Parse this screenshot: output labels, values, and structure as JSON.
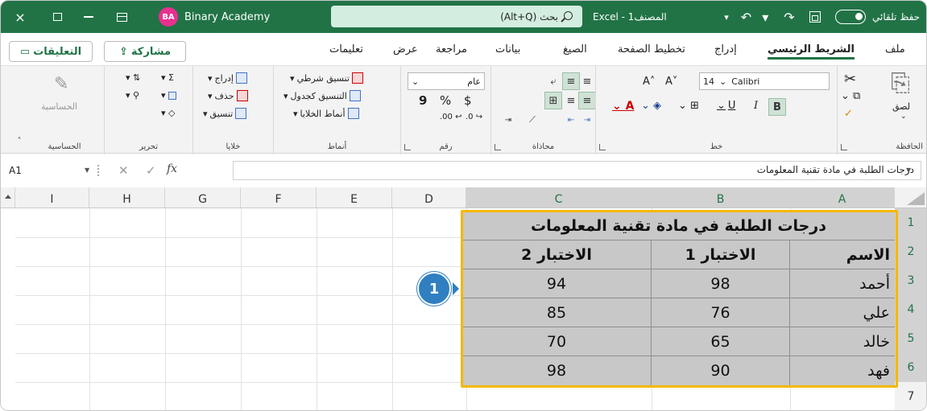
{
  "titlebar": {
    "close": "×",
    "avatar_initials": "BA",
    "user_name": "Binary Academy",
    "search_placeholder": "(Alt+Q) بحث",
    "document_title": "Excel - المصنف1",
    "customize": "▾",
    "undo": "↶ ▾",
    "redo": "↷",
    "autosave_label": "حفظ تلقائي",
    "accent_color": "#217346"
  },
  "tabs": {
    "file": "ملف",
    "home": "الشريط الرئيسي",
    "insert": "إدراج",
    "page_layout": "تخطيط الصفحة",
    "formulas": "الصيغ",
    "data": "بيانات",
    "review": "مراجعة",
    "view": "عرض",
    "help": "تعليمات",
    "share": "مشاركة",
    "comments": "التعليقات"
  },
  "ribbon": {
    "clipboard": {
      "label": "الحافظة",
      "paste": "لصق"
    },
    "font": {
      "label": "خط",
      "font_name": "Calibri",
      "font_size": "14",
      "bold": "B",
      "italic": "I",
      "underline": "U",
      "grow": "A˄",
      "shrink": "A˅"
    },
    "alignment": {
      "label": "محاذاة"
    },
    "number": {
      "label": "رقم",
      "format": "عام",
      "currency": "$",
      "percent": "%",
      "comma": "9"
    },
    "styles": {
      "label": "أنماط",
      "conditional": "تنسيق شرطي",
      "as_table": "التنسيق كجدول",
      "cell_styles": "أنماط الخلايا"
    },
    "cells": {
      "label": "خلايا",
      "insert": "إدراج",
      "delete": "حذف",
      "format": "تنسيق"
    },
    "editing": {
      "label": "تحرير"
    },
    "sensitivity": {
      "label": "الحساسية",
      "button": "الحساسية"
    }
  },
  "formula_bar": {
    "name_box": "A1",
    "fx": "fx",
    "content": "درجات الطلبة في مادة تقنية المعلومات"
  },
  "grid": {
    "columns": [
      "I",
      "H",
      "G",
      "F",
      "E",
      "D",
      "C",
      "B",
      "A"
    ],
    "rows": [
      "1",
      "2",
      "3",
      "4",
      "5",
      "6",
      "7"
    ],
    "table": {
      "title": "درجات الطلبة في مادة تقنية المعلومات",
      "headers": {
        "name": "الاسم",
        "test1": "الاختبار 1",
        "test2": "الاختبار 2"
      },
      "records": [
        {
          "name": "أحمد",
          "test1": "98",
          "test2": "94"
        },
        {
          "name": "علي",
          "test1": "76",
          "test2": "85"
        },
        {
          "name": "خالد",
          "test1": "65",
          "test2": "70"
        },
        {
          "name": "فهد",
          "test1": "90",
          "test2": "98"
        }
      ]
    },
    "highlight_color": "#f5b800"
  },
  "callout": {
    "number": "1",
    "color": "#2f7fc1"
  }
}
